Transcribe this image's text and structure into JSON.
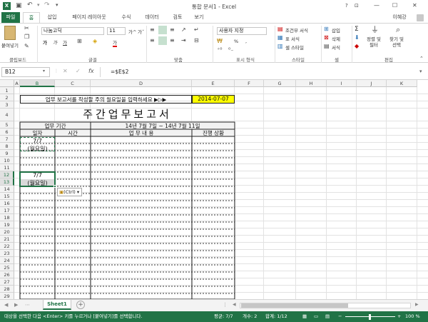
{
  "window": {
    "title": "통합 문서1 - Excel",
    "user": "이혜강",
    "help": "?",
    "min": "—",
    "max": "☐",
    "close": "✕"
  },
  "tabs": [
    "파일",
    "홈",
    "삽입",
    "페이지 레이아웃",
    "수식",
    "데이터",
    "검토",
    "보기"
  ],
  "ribbon": {
    "clipboard": {
      "paste": "붙여넣기",
      "label": "클립보드"
    },
    "font": {
      "name": "나눔고딕",
      "size": "11",
      "label": "글꼴",
      "grow": "가^",
      "shrink": "가ˇ",
      "bold": "가",
      "italic": "가",
      "underline": "가",
      "fontcolor": "가"
    },
    "alignment": {
      "label": "맞춤"
    },
    "number": {
      "format": "사용자 지정",
      "label": "표시 형식",
      "percent": "%",
      "comma": ","
    },
    "styles": {
      "cond": "조건부 서식",
      "table": "표 서식",
      "cell": "셀 스타일",
      "label": "스타일"
    },
    "cells": {
      "insert": "삽입",
      "delete": "삭제",
      "format": "서식",
      "label": "셀"
    },
    "editing": {
      "sort": "정렬 및\n필터",
      "find": "찾기 및\n선택",
      "label": "편집",
      "sum": "Σ"
    }
  },
  "formula": {
    "namebox": "B12",
    "fx": "fx",
    "formula": "=$E$2"
  },
  "columns": [
    "A",
    "B",
    "C",
    "D",
    "E",
    "F",
    "G",
    "H",
    "I",
    "J",
    "K"
  ],
  "rows": [
    "1",
    "2",
    "3",
    "4",
    "5",
    "6",
    "7",
    "8",
    "9",
    "10",
    "11",
    "12",
    "13",
    "14",
    "15",
    "16",
    "17",
    "18",
    "19",
    "20",
    "21",
    "22",
    "23",
    "24",
    "25",
    "26",
    "27",
    "28",
    "29",
    "30"
  ],
  "cells": {
    "instruction": "업무 보고서를 작성할 주의 월요일을 입력하세요 ▶▷▶",
    "date": "2014-07-07",
    "title": "주간업무보고서",
    "period_label": "업무 기간",
    "period_value": "14년 7월 7일 ~ 14년 7월 11일",
    "col_date": "일자",
    "col_time": "시간",
    "col_content": "업 무 내 용",
    "col_status": "진행 상황",
    "b8": "7/7",
    "b9": "(월요일)",
    "b12": "7/7",
    "b13": "(월요일)"
  },
  "paste_options": "(Ctrl)",
  "sheet": {
    "tab": "Sheet1",
    "add": "+"
  },
  "status": {
    "message": "대상을 선택한 다음 <Enter> 키를 누르거나 [붙여넣기]를 선택합니다.",
    "average": "평균: 7/7",
    "count": "개수: 2",
    "sum": "합계: 1/12",
    "zoom": "100 %"
  },
  "colors": {
    "accent": "#217346",
    "highlight": "#ffff00"
  }
}
